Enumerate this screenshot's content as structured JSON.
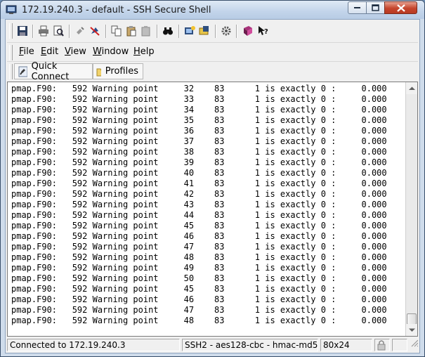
{
  "window": {
    "title": "172.19.240.3 - default - SSH Secure Shell"
  },
  "menu": {
    "file": {
      "accel": "F",
      "rest": "ile"
    },
    "edit": {
      "accel": "E",
      "rest": "dit"
    },
    "view": {
      "accel": "V",
      "rest": "iew"
    },
    "window": {
      "accel": "W",
      "rest": "indow"
    },
    "help": {
      "accel": "H",
      "rest": "elp"
    }
  },
  "toolbar": {
    "icons": [
      "save-icon",
      "print-icon",
      "print-preview-icon",
      "disconnect-icon",
      "stop-icon",
      "copy-icon",
      "paste-icon",
      "paste-disabled-icon",
      "find-icon",
      "settings-icon",
      "new-file-transfer-icon",
      "help-icon",
      "info-icon",
      "context-help-icon"
    ]
  },
  "profiles_bar": {
    "quick_connect_label": "Quick Connect",
    "profiles_label": "Profiles"
  },
  "terminal": {
    "lines": [
      "pmap.F90:   592 Warning point     32    83      1 is exactly 0 :     0.000",
      "pmap.F90:   592 Warning point     33    83      1 is exactly 0 :     0.000",
      "pmap.F90:   592 Warning point     34    83      1 is exactly 0 :     0.000",
      "pmap.F90:   592 Warning point     35    83      1 is exactly 0 :     0.000",
      "pmap.F90:   592 Warning point     36    83      1 is exactly 0 :     0.000",
      "pmap.F90:   592 Warning point     37    83      1 is exactly 0 :     0.000",
      "pmap.F90:   592 Warning point     38    83      1 is exactly 0 :     0.000",
      "pmap.F90:   592 Warning point     39    83      1 is exactly 0 :     0.000",
      "pmap.F90:   592 Warning point     40    83      1 is exactly 0 :     0.000",
      "pmap.F90:   592 Warning point     41    83      1 is exactly 0 :     0.000",
      "pmap.F90:   592 Warning point     42    83      1 is exactly 0 :     0.000",
      "pmap.F90:   592 Warning point     43    83      1 is exactly 0 :     0.000",
      "pmap.F90:   592 Warning point     44    83      1 is exactly 0 :     0.000",
      "pmap.F90:   592 Warning point     45    83      1 is exactly 0 :     0.000",
      "pmap.F90:   592 Warning point     46    83      1 is exactly 0 :     0.000",
      "pmap.F90:   592 Warning point     47    83      1 is exactly 0 :     0.000",
      "pmap.F90:   592 Warning point     48    83      1 is exactly 0 :     0.000",
      "pmap.F90:   592 Warning point     49    83      1 is exactly 0 :     0.000",
      "pmap.F90:   592 Warning point     50    83      1 is exactly 0 :     0.000",
      "pmap.F90:   592 Warning point     45    83      1 is exactly 0 :     0.000",
      "pmap.F90:   592 Warning point     46    83      1 is exactly 0 :     0.000",
      "pmap.F90:   592 Warning point     47    83      1 is exactly 0 :     0.000",
      "pmap.F90:   592 Warning point     48    83      1 is exactly 0 :     0.000"
    ]
  },
  "status": {
    "connection": "Connected to 172.19.240.3",
    "cipher": "SSH2 - aes128-cbc - hmac-md5",
    "size": "80x24"
  },
  "colors": {
    "title_gradient_top": "#dfe9f5",
    "close_button": "#c5452c",
    "terminal_bg": "#ffffff"
  }
}
